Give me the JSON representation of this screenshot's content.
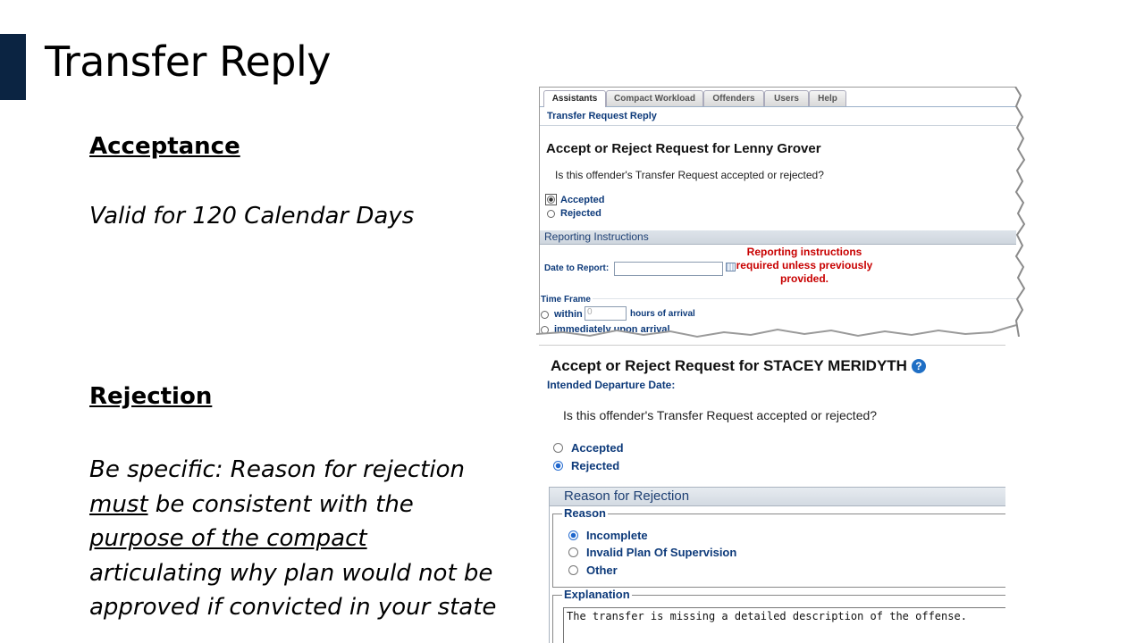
{
  "slide": {
    "title": "Transfer Reply",
    "acceptance_heading": "Acceptance",
    "acceptance_text": "Valid for 120 Calendar  Days",
    "rejection_heading": "Rejection",
    "rejection_lines": [
      {
        "pre": "Be specific:  Reason for rejection",
        "u": "",
        "post": ""
      },
      {
        "pre": "",
        "u": "must",
        "post": " be consistent  with the"
      },
      {
        "pre": "",
        "u": "purpose  of the compact",
        "post": ""
      },
      {
        "pre": "articulating  why plan would not be",
        "u": "",
        "post": ""
      },
      {
        "pre": "approved  if convicted  in your state",
        "u": "",
        "post": ""
      }
    ]
  },
  "screenshot1": {
    "tabs": [
      "Assistants",
      "Compact Workload",
      "Offenders",
      "Users",
      "Help"
    ],
    "active_tab": "Assistants",
    "breadcrumb": "Transfer Request Reply",
    "heading": "Accept or Reject Request for Lenny Grover",
    "question": "Is this offender's Transfer Request accepted or rejected?",
    "options": [
      "Accepted",
      "Rejected"
    ],
    "selected": "Accepted",
    "section_title": "Reporting Instructions",
    "date_label": "Date to Report:",
    "warning": "Reporting instructions required unless previously provided.",
    "time_frame_label": "Time Frame",
    "within_label": "within",
    "within_value": "0",
    "hours_label": "hours of arrival",
    "immediately_label": "immediately upon arrival"
  },
  "screenshot2": {
    "heading": "Accept or Reject Request for STACEY MERIDYTH",
    "help_icon": "?",
    "departure_label": "Intended Departure Date:",
    "question": "Is this offender's Transfer Request accepted or rejected?",
    "options": [
      "Accepted",
      "Rejected"
    ],
    "selected": "Rejected",
    "panel_title": "Reason for Rejection",
    "reason_legend": "Reason",
    "reasons": [
      "Incomplete",
      "Invalid Plan Of Supervision",
      "Other"
    ],
    "selected_reason": "Incomplete",
    "explanation_legend": "Explanation",
    "explanation_text": "The transfer is missing a detailed description of the offense."
  },
  "colors": {
    "accent_bar": "#0b2442",
    "link_blue": "#0d3a7a",
    "warning_red": "#c80000"
  }
}
